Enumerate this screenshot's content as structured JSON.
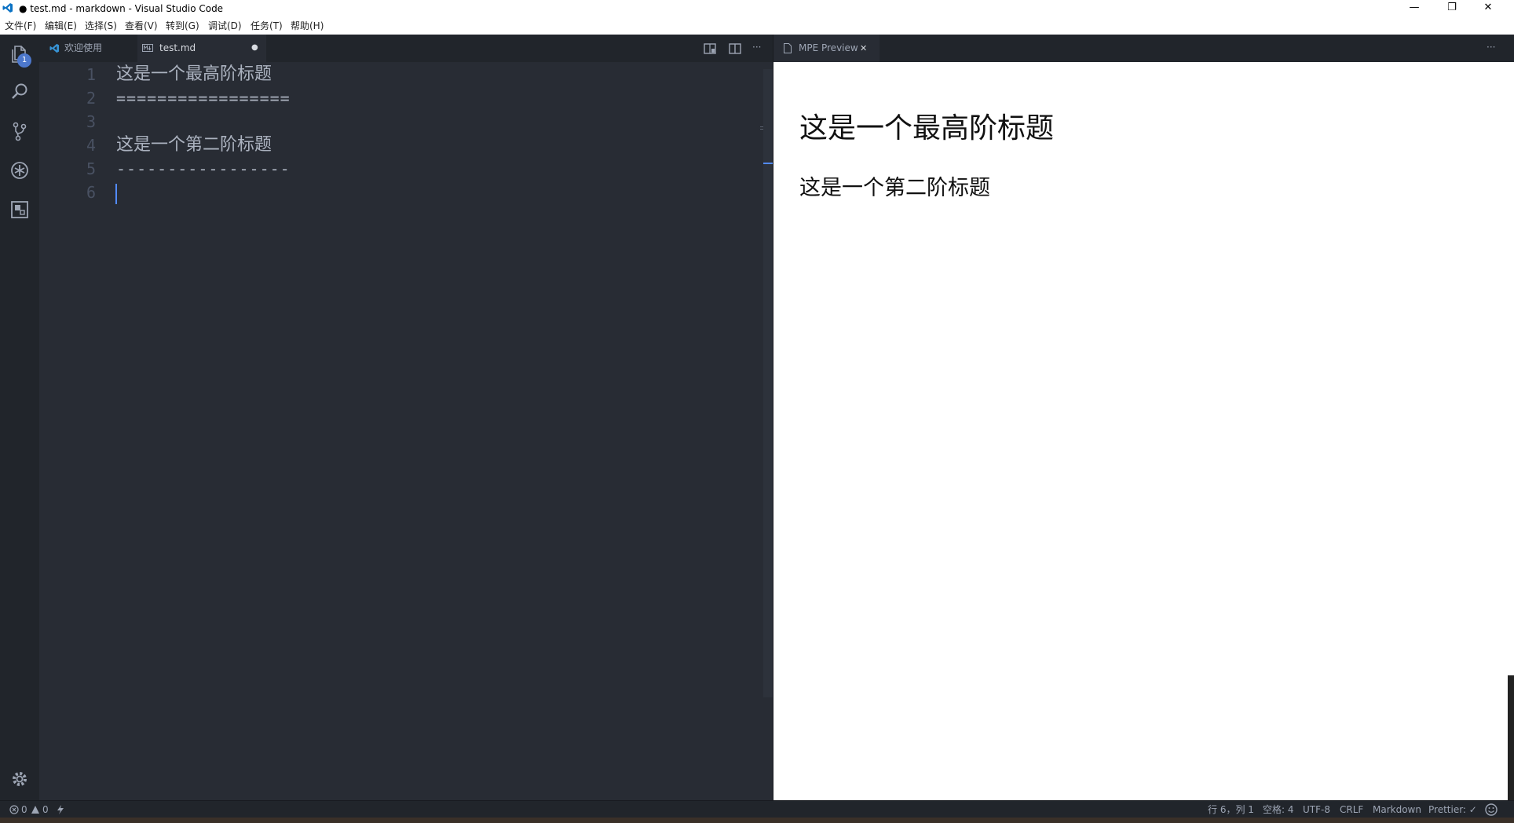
{
  "window": {
    "title": "● test.md - markdown - Visual Studio Code",
    "minimize_glyph": "—",
    "restore_glyph": "❐",
    "close_glyph": "✕"
  },
  "menubar": {
    "items": [
      "文件(F)",
      "编辑(E)",
      "选择(S)",
      "查看(V)",
      "转到(G)",
      "调试(D)",
      "任务(T)",
      "帮助(H)"
    ]
  },
  "activity_bar": {
    "explorer_badge": "1"
  },
  "left_tabs": {
    "welcome_label": "欢迎使用",
    "test_label": "test.md",
    "test_dirty_glyph": "●",
    "more_glyph": "···"
  },
  "editor": {
    "lines": [
      {
        "num": "1",
        "text": "这是一个最高阶标题"
      },
      {
        "num": "2",
        "text": "================="
      },
      {
        "num": "3",
        "text": ""
      },
      {
        "num": "4",
        "text": "这是一个第二阶标题"
      },
      {
        "num": "5",
        "text": "-----------------"
      },
      {
        "num": "6",
        "text": ""
      }
    ]
  },
  "right_tabs": {
    "preview_label": "MPE Preview",
    "close_glyph": "✕",
    "more_glyph": "···"
  },
  "preview": {
    "h1": "这是一个最高阶标题",
    "h2": "这是一个第二阶标题"
  },
  "statusbar": {
    "errors": "0",
    "warnings": "0",
    "position": "行 6，列 1",
    "indent": "空格: 4",
    "encoding": "UTF-8",
    "eol": "CRLF",
    "language": "Markdown",
    "formatter": "Prettier: ✓"
  },
  "colors": {
    "accent": "#528bff",
    "badge": "#4d78cc",
    "editor_bg": "#282c34",
    "chrome_bg": "#21252b"
  }
}
